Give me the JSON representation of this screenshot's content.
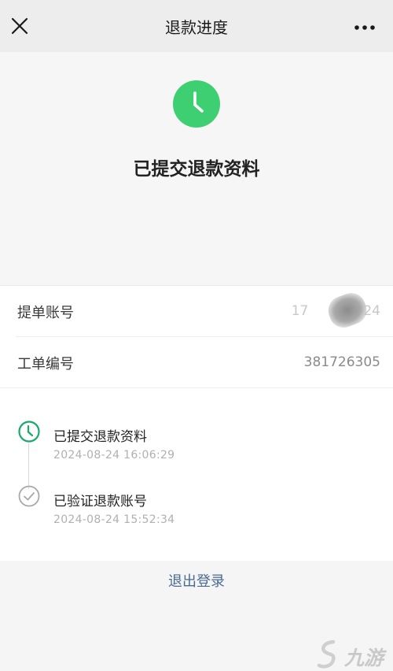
{
  "navbar": {
    "title": "退款进度",
    "close_icon": "close-icon",
    "more_icon": "more-dots-icon"
  },
  "hero": {
    "icon": "clock-icon",
    "status": "已提交退款资料",
    "accent_color": "#3fcf73"
  },
  "info": {
    "rows": [
      {
        "label": "提单账号",
        "value_prefix": "17",
        "value_suffix": "24"
      },
      {
        "label": "工单编号",
        "value": "381726305"
      }
    ]
  },
  "timeline": {
    "steps": [
      {
        "title": "已提交退款资料",
        "time": "2024-08-24 16:06:29",
        "icon": "clock-icon",
        "color": "#19a96b"
      },
      {
        "title": "已验证退款账号",
        "time": "2024-08-24 15:52:34",
        "icon": "check-circle-icon",
        "color": "#a8a8a8"
      }
    ]
  },
  "footer": {
    "logout_label": "退出登录",
    "link_color": "#4a6a94"
  },
  "watermark": {
    "text": "九游"
  }
}
